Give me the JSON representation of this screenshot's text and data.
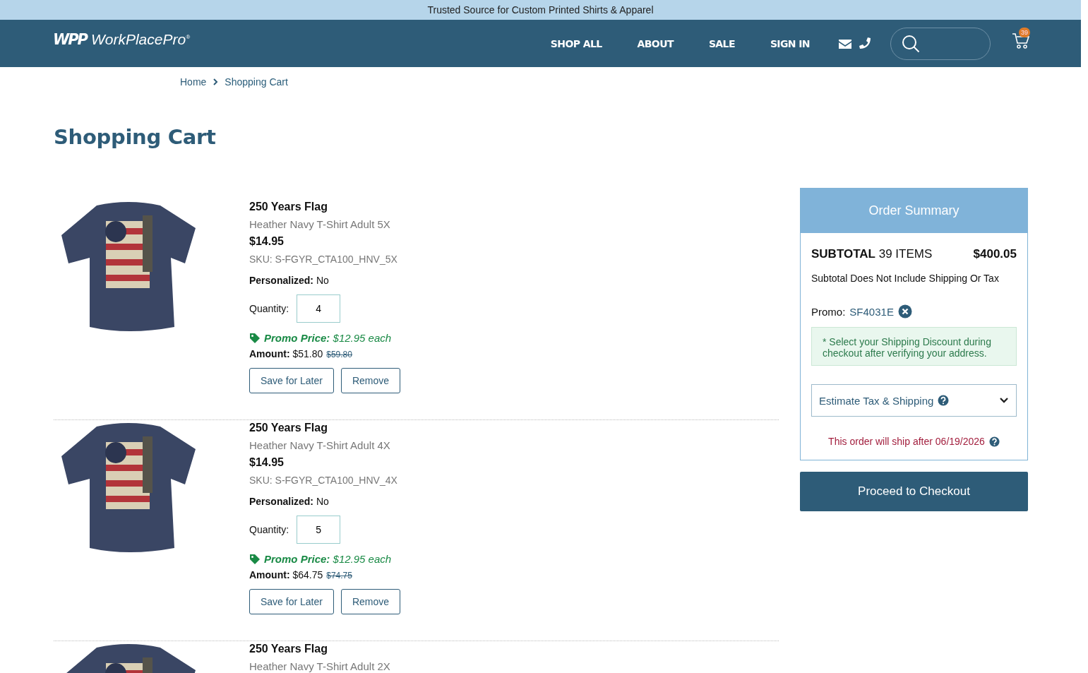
{
  "announcement": "Trusted Source for Custom Printed Shirts & Apparel",
  "header": {
    "logo_mark": "WPP",
    "logo_text": "WorkPlacePro",
    "logo_registered": "®",
    "nav": [
      "SHOP ALL",
      "ABOUT",
      "SALE",
      "SIGN IN"
    ],
    "cart_count": "39"
  },
  "breadcrumb": [
    "Home",
    "Shopping Cart"
  ],
  "page_title": "Shopping Cart",
  "items": [
    {
      "title": "250 Years Flag",
      "variant": "Heather Navy T-Shirt Adult 5X",
      "price": "$14.95",
      "sku": "SKU: S-FGYR_CTA100_HNV_5X",
      "personalized_label": "Personalized:",
      "personalized_value": "No",
      "quantity_label": "Quantity:",
      "quantity": "4",
      "promo_label": "Promo Price:",
      "promo_value": "$12.95 each",
      "amount_label": "Amount:",
      "amount": "$51.80",
      "original_amount": "$59.80",
      "buttons": [
        "Save for Later",
        "Remove"
      ]
    },
    {
      "title": "250 Years Flag",
      "variant": "Heather Navy T-Shirt Adult 4X",
      "price": "$14.95",
      "sku": "SKU: S-FGYR_CTA100_HNV_4X",
      "personalized_label": "Personalized:",
      "personalized_value": "No",
      "quantity_label": "Quantity:",
      "quantity": "5",
      "promo_label": "Promo Price:",
      "promo_value": "$12.95 each",
      "amount_label": "Amount:",
      "amount": "$64.75",
      "original_amount": "$74.75",
      "buttons": [
        "Save for Later",
        "Remove"
      ]
    },
    {
      "title": "250 Years Flag",
      "variant": "Heather Navy T-Shirt Adult 2X"
    }
  ],
  "summary": {
    "title": "Order Summary",
    "subtotal_label": "SUBTOTAL",
    "subtotal_items": "39 ITEMS",
    "subtotal_value": "$400.05",
    "subtotal_note": "Subtotal Does Not Include Shipping Or Tax",
    "promo_label": "Promo:",
    "promo_code": "SF4031E",
    "shipping_notice": "* Select your Shipping Discount during checkout after verifying your address.",
    "estimate_label": "Estimate Tax & Shipping",
    "estimate_expanded": false,
    "ship_date_notice": "This order will ship after 06/19/2026",
    "checkout_button": "Proceed to Checkout"
  }
}
